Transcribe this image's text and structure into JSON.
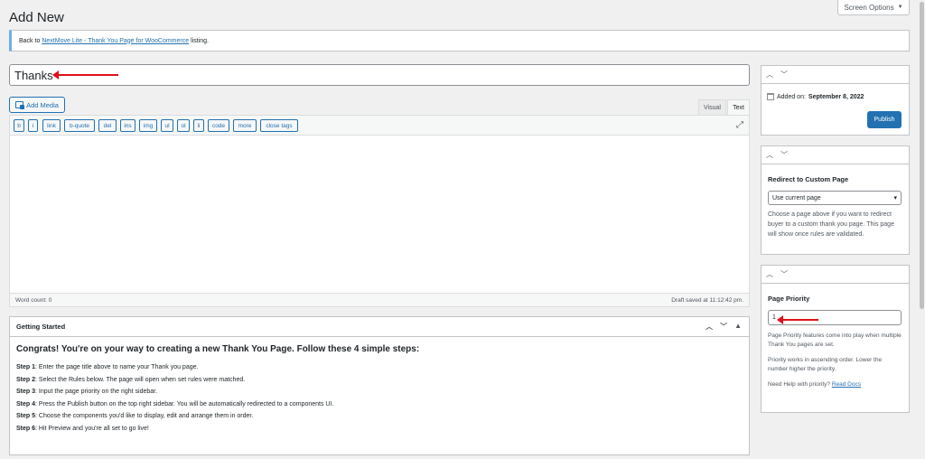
{
  "header": {
    "title": "Add New",
    "screen_options": "Screen Options"
  },
  "notice": {
    "prefix": "Back to",
    "link": "NextMove Lite - Thank You Page for WooCommerce",
    "suffix": "listing."
  },
  "title_input": {
    "value": "Thanks"
  },
  "editor": {
    "add_media": "Add Media",
    "tabs": [
      "Visual",
      "Text"
    ],
    "quicktags": [
      "b",
      "i",
      "link",
      "b-quote",
      "del",
      "ins",
      "img",
      "ul",
      "ol",
      "li",
      "code",
      "more",
      "close tags"
    ],
    "word_count": "Word count: 0",
    "draft_saved": "Draft saved at 11:12:42 pm."
  },
  "getting_started": {
    "title": "Getting Started",
    "heading": "Congrats! You're on your way to creating a new Thank You Page. Follow these 4 simple steps:",
    "steps": [
      {
        "label": "Step 1",
        "text": ": Enter the page title above to name your Thank you page."
      },
      {
        "label": "Step 2",
        "text": ": Select the Rules below. The page will open when set rules were matched."
      },
      {
        "label": "Step 3",
        "text": ": Input the page priority on the right sidebar."
      },
      {
        "label": "Step 4",
        "text": ": Press the Publish button on the top right sidebar. You will be automatically redirected to a components UI."
      },
      {
        "label": "Step 5",
        "text": ": Choose the components you'd like to display, edit and arrange them in order."
      },
      {
        "label": "Step 6",
        "text": ": Hit Preview and you're all set to go live!"
      }
    ]
  },
  "publish_box": {
    "added_label": "Added on:",
    "added_date": "September 8, 2022",
    "publish": "Publish"
  },
  "redirect_box": {
    "title": "Redirect to Custom Page",
    "selected": "Use current page",
    "help": "Choose a page above if you want to redirect buyer to a custom thank you page. This page will show once rules are validated."
  },
  "priority_box": {
    "title": "Page Priority",
    "value": "1",
    "help1": "Page Priority features come into play when multiple Thank You pages are set.",
    "help2": "Priority works in ascending order. Lower the number higher the priority.",
    "help3": "Need Help with priority?",
    "link": "Read Docs"
  },
  "colors": {
    "accent": "#2271b1",
    "arrow": "#e0101a"
  }
}
